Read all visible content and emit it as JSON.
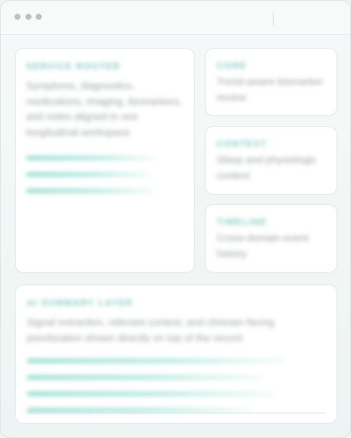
{
  "window": {
    "controls": [
      "close",
      "minimize",
      "maximize"
    ]
  },
  "cards": {
    "main": {
      "kicker": "SERVICE ROUTER",
      "body": "Symptoms, diagnostics, medications, imaging, biomarkers, and notes aligned in one longitudinal workspace",
      "meters": [
        1,
        2,
        3
      ]
    },
    "side": [
      {
        "kicker": "CORE",
        "body": "Trend-aware biomarker review"
      },
      {
        "kicker": "CONTEXT",
        "body": "Sleep and physiologic context"
      },
      {
        "kicker": "TIMELINE",
        "body": "Cross-domain event history"
      }
    ],
    "bottom": {
      "kicker": "AI SUMMARY LAYER",
      "body": "Signal extraction, relevant context, and clinician-facing prioritization shown directly on top of the record",
      "meters": [
        1,
        2,
        3,
        4
      ]
    }
  },
  "colors": {
    "accent": "#7fc9bd",
    "meter": "#a6e2d7",
    "text": "#9aa3a2",
    "background": "#eef4f3"
  }
}
